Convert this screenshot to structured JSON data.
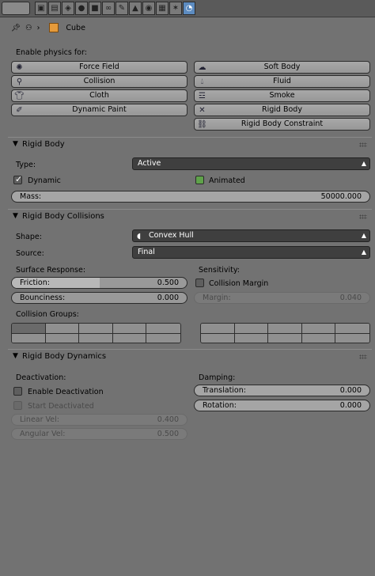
{
  "breadcrumb": {
    "object": "Cube"
  },
  "physics": {
    "title": "Enable physics for:",
    "left": [
      "Force Field",
      "Collision",
      "Cloth",
      "Dynamic Paint"
    ],
    "right": [
      "Soft Body",
      "Fluid",
      "Smoke",
      "Rigid Body",
      "Rigid Body Constraint"
    ]
  },
  "rigid_body": {
    "title": "Rigid Body",
    "type_label": "Type:",
    "type_value": "Active",
    "dynamic": "Dynamic",
    "animated": "Animated",
    "mass_label": "Mass:",
    "mass_value": "50000.000"
  },
  "collisions": {
    "title": "Rigid Body Collisions",
    "shape_label": "Shape:",
    "shape_value": "Convex Hull",
    "source_label": "Source:",
    "source_value": "Final",
    "surface_label": "Surface Response:",
    "friction_label": "Friction:",
    "friction_value": "0.500",
    "friction_fraction": 0.5,
    "bounciness_label": "Bounciness:",
    "bounciness_value": "0.000",
    "sensitivity_label": "Sensitivity:",
    "margin_toggle": "Collision Margin",
    "margin_label": "Margin:",
    "margin_value": "0.040",
    "groups_label": "Collision Groups:"
  },
  "dynamics": {
    "title": "Rigid Body Dynamics",
    "deactivation_label": "Deactivation:",
    "enable_deactivation": "Enable Deactivation",
    "start_deactivated": "Start Deactivated",
    "linear_label": "Linear Vel:",
    "linear_value": "0.400",
    "angular_label": "Angular Vel:",
    "angular_value": "0.500",
    "damping_label": "Damping:",
    "translation_label": "Translation:",
    "translation_value": "0.000",
    "rotation_label": "Rotation:",
    "rotation_value": "0.000"
  },
  "colors": {
    "active_tab": "#5c8bc0",
    "dropdown": "#3f3f3f",
    "animated_check": "#5fa24a"
  }
}
